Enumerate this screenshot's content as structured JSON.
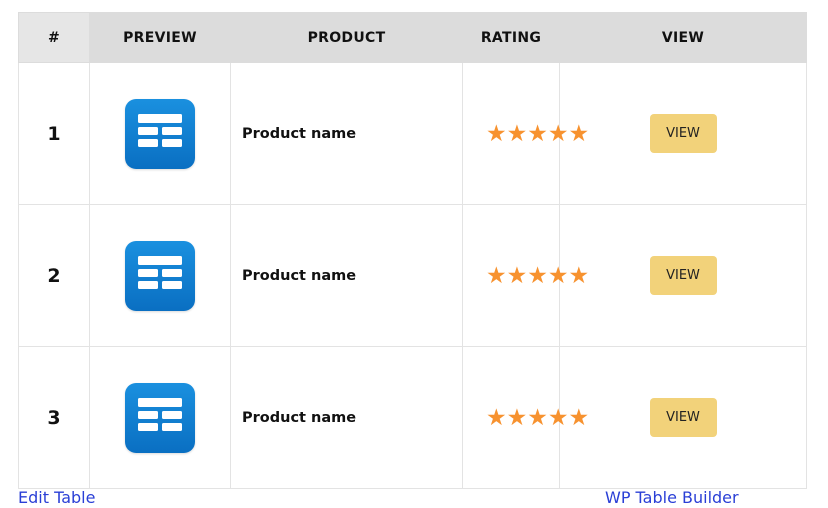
{
  "columns": [
    "#",
    "PREVIEW",
    "PRODUCT",
    "RATING",
    "VIEW"
  ],
  "rows": [
    {
      "num": "1",
      "icon": "table-icon",
      "product": "Product name",
      "rating": 5,
      "view_label": "VIEW"
    },
    {
      "num": "2",
      "icon": "table-icon",
      "product": "Product name",
      "rating": 5,
      "view_label": "VIEW"
    },
    {
      "num": "3",
      "icon": "table-icon",
      "product": "Product name",
      "rating": 5,
      "view_label": "VIEW"
    }
  ],
  "footer": {
    "left_link": "Edit Table",
    "right_link": "WP Table Builder"
  },
  "colors": {
    "header_bg": "#dcdcdc",
    "star": "#f7922f",
    "button_bg": "#f2d27a",
    "icon_blue": "#0a78cc",
    "link": "#2a3fd6"
  }
}
